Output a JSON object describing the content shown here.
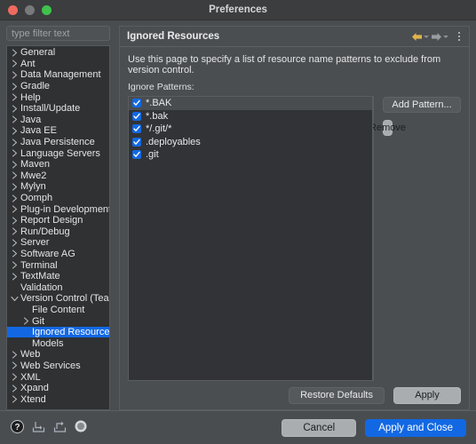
{
  "window": {
    "title": "Preferences",
    "traffic_lights": [
      "close-button",
      "minimize-button",
      "zoom-button"
    ]
  },
  "sidebar": {
    "filter": {
      "value": "",
      "placeholder": "type filter text"
    },
    "items": [
      {
        "label": "General",
        "level": 1,
        "twisty": "collapsed",
        "selected": false
      },
      {
        "label": "Ant",
        "level": 1,
        "twisty": "collapsed",
        "selected": false
      },
      {
        "label": "Data Management",
        "level": 1,
        "twisty": "collapsed",
        "selected": false
      },
      {
        "label": "Gradle",
        "level": 1,
        "twisty": "collapsed",
        "selected": false
      },
      {
        "label": "Help",
        "level": 1,
        "twisty": "collapsed",
        "selected": false
      },
      {
        "label": "Install/Update",
        "level": 1,
        "twisty": "collapsed",
        "selected": false
      },
      {
        "label": "Java",
        "level": 1,
        "twisty": "collapsed",
        "selected": false
      },
      {
        "label": "Java EE",
        "level": 1,
        "twisty": "collapsed",
        "selected": false
      },
      {
        "label": "Java Persistence",
        "level": 1,
        "twisty": "collapsed",
        "selected": false
      },
      {
        "label": "Language Servers",
        "level": 1,
        "twisty": "collapsed",
        "selected": false
      },
      {
        "label": "Maven",
        "level": 1,
        "twisty": "collapsed",
        "selected": false
      },
      {
        "label": "Mwe2",
        "level": 1,
        "twisty": "collapsed",
        "selected": false
      },
      {
        "label": "Mylyn",
        "level": 1,
        "twisty": "collapsed",
        "selected": false
      },
      {
        "label": "Oomph",
        "level": 1,
        "twisty": "collapsed",
        "selected": false
      },
      {
        "label": "Plug-in Development",
        "level": 1,
        "twisty": "collapsed",
        "selected": false
      },
      {
        "label": "Report Design",
        "level": 1,
        "twisty": "collapsed",
        "selected": false
      },
      {
        "label": "Run/Debug",
        "level": 1,
        "twisty": "collapsed",
        "selected": false
      },
      {
        "label": "Server",
        "level": 1,
        "twisty": "collapsed",
        "selected": false
      },
      {
        "label": "Software AG",
        "level": 1,
        "twisty": "collapsed",
        "selected": false
      },
      {
        "label": "Terminal",
        "level": 1,
        "twisty": "collapsed",
        "selected": false
      },
      {
        "label": "TextMate",
        "level": 1,
        "twisty": "collapsed",
        "selected": false
      },
      {
        "label": "Validation",
        "level": 1,
        "twisty": "none",
        "selected": false
      },
      {
        "label": "Version Control (Team)",
        "level": 1,
        "twisty": "expanded",
        "selected": false
      },
      {
        "label": "File Content",
        "level": 2,
        "twisty": "none",
        "selected": false
      },
      {
        "label": "Git",
        "level": 2,
        "twisty": "collapsed",
        "selected": false
      },
      {
        "label": "Ignored Resources",
        "level": 2,
        "twisty": "none",
        "selected": true
      },
      {
        "label": "Models",
        "level": 2,
        "twisty": "none",
        "selected": false
      },
      {
        "label": "Web",
        "level": 1,
        "twisty": "collapsed",
        "selected": false
      },
      {
        "label": "Web Services",
        "level": 1,
        "twisty": "collapsed",
        "selected": false
      },
      {
        "label": "XML",
        "level": 1,
        "twisty": "collapsed",
        "selected": false
      },
      {
        "label": "Xpand",
        "level": 1,
        "twisty": "collapsed",
        "selected": false
      },
      {
        "label": "Xtend",
        "level": 1,
        "twisty": "collapsed",
        "selected": false
      }
    ]
  },
  "content": {
    "title": "Ignored Resources",
    "nav": {
      "back_icon": "back-arrow-icon",
      "forward_icon": "forward-arrow-icon",
      "menu_icon": "kebab-menu-icon",
      "back_enabled": true,
      "forward_enabled": false
    },
    "description": "Use this page to specify a list of resource name patterns to exclude from version control.",
    "list_label": "Ignore Patterns:",
    "patterns": [
      {
        "label": "*.BAK",
        "checked": true,
        "focused": true
      },
      {
        "label": "*.bak",
        "checked": true,
        "focused": false
      },
      {
        "label": "*/.git/*",
        "checked": true,
        "focused": false
      },
      {
        "label": ".deployables",
        "checked": true,
        "focused": false
      },
      {
        "label": ".git",
        "checked": true,
        "focused": false
      }
    ],
    "buttons": {
      "add_pattern": "Add Pattern...",
      "remove": "Remove",
      "restore_defaults": "Restore Defaults",
      "apply": "Apply"
    }
  },
  "footer": {
    "icons": [
      "help-icon",
      "import-preferences-icon",
      "export-preferences-icon",
      "status-circle-icon"
    ],
    "cancel": "Cancel",
    "apply_and_close": "Apply and Close"
  },
  "colors": {
    "accent_blue": "#1268e3",
    "window_bg": "#4a4d50",
    "titlebar_bg": "#3b3d3f",
    "tree_bg": "#2f3133",
    "list_bg": "#313336",
    "back_arrow": "#e0b44a",
    "forward_arrow": "#9a9da0",
    "light_button": "#a9adb0"
  }
}
